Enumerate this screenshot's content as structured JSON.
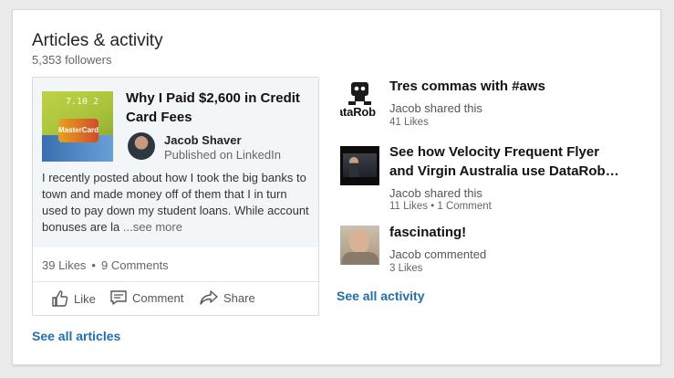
{
  "section": {
    "title": "Articles & activity",
    "followers": "5,353 followers"
  },
  "article": {
    "title": "Why I Paid $2,600 in Credit Card Fees",
    "author": "Jacob Shaver",
    "published": "Published on LinkedIn",
    "excerpt": "I recently posted about how I took the big banks to town and made money off of them that I in turn used to pay down my student loans. While account bonuses are la",
    "see_more": "...see more",
    "likes": "39 Likes",
    "comments": "9 Comments",
    "thumb_text": "MasterCard",
    "thumb_number": "7.10 2",
    "actions": {
      "like": "Like",
      "comment": "Comment",
      "share": "Share"
    }
  },
  "see_all_articles": "See all articles",
  "activity": [
    {
      "title": "Tres commas with #aws",
      "meta": "Jacob shared this",
      "stats": "41 Likes",
      "thumb_label": "ataRob",
      "thumb": "robot-logo"
    },
    {
      "title": "See how Velocity Frequent Flyer",
      "title2": "and Virgin Australia use DataRob…",
      "meta": "Jacob shared this",
      "stats": "11 Likes • 1 Comment",
      "thumb": "video-frame"
    },
    {
      "title": "fascinating!",
      "meta": "Jacob commented",
      "stats": "3 Likes",
      "thumb": "person-photo"
    }
  ],
  "see_all_activity": "See all activity",
  "colors": {
    "link": "#1f6fb5",
    "card_bg": "#ffffff",
    "article_bg": "#f3f6f8"
  }
}
